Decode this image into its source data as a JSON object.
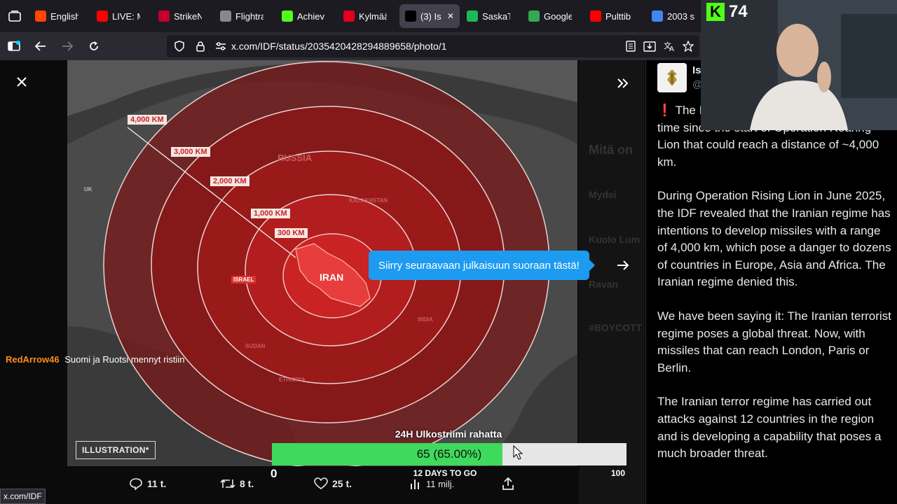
{
  "browser": {
    "tabs": [
      {
        "title": "English",
        "icon": "reddit-icon",
        "color": "#ff4500"
      },
      {
        "title": "LIVE: M",
        "icon": "youtube-icon",
        "color": "#ff0000"
      },
      {
        "title": "StrikeN",
        "icon": "mute-icon",
        "color": "#c4002b"
      },
      {
        "title": "Flightra",
        "icon": "radar-icon",
        "color": "#888888"
      },
      {
        "title": "Achiev",
        "icon": "kick-icon",
        "color": "#53fc18"
      },
      {
        "title": "Kylmää",
        "icon": "news-icon",
        "color": "#e3001b"
      },
      {
        "title": "(3) Is",
        "icon": "x-icon",
        "color": "#000000"
      },
      {
        "title": "SaskaT",
        "icon": "spotify-icon",
        "color": "#1db954"
      },
      {
        "title": "Google",
        "icon": "maps-icon",
        "color": "#34a853"
      },
      {
        "title": "Pulttib",
        "icon": "youtube-icon",
        "color": "#ff0000"
      },
      {
        "title": "2003 s",
        "icon": "google-icon",
        "color": "#4285f4"
      }
    ],
    "active_tab_index": 6,
    "url": "x.com/IDF/status/2035420428294889658/photo/1",
    "status_url": "x.com/IDF"
  },
  "map": {
    "country_labels": [
      "RUSSIA",
      "KAZAKHSTAN",
      "UK",
      "SUDAN",
      "ETHIOPIA",
      "INDIA"
    ],
    "iran_label": "IRAN",
    "israel_label": "ISRAEL",
    "range_labels": [
      "4,000 KM",
      "3,000 KM",
      "2,000 KM",
      "1,000 KM",
      "300 KM"
    ],
    "illustration_tag": "ILLUSTRATION*"
  },
  "tooltip": {
    "text": "Siirry seuraavaan julkaisuun suoraan tästä!"
  },
  "chat": {
    "user": "RedArrow46",
    "message": "Suomi ja Ruotsi mennyt ristiin"
  },
  "goal": {
    "title": "24H Ulkostriimi rahatta",
    "value_text": "65 (65.00%)",
    "progress": 0.65,
    "min": "0",
    "max": "100",
    "days_text": "12 DAYS TO GO"
  },
  "actions": {
    "replies": "11 t.",
    "reposts": "8 t.",
    "likes": "25 t.",
    "views": "11 milj."
  },
  "background_timeline": [
    "Mitä on",
    "Mydei",
    "Kuolo Lum",
    "Ravan",
    "#BOYCOTT"
  ],
  "tweet": {
    "author_name": "Is",
    "author_handle": "@",
    "paragraphs": [
      "The I... a long-range missile for the first time since the start of Operation Roaring Lion that could reach a distance of ~4,000 km.",
      "During Operation Rising Lion in June 2025, the IDF revealed that the Iranian regime has intentions to develop missiles with a range of 4,000 km, which pose a danger to dozens of countries in Europe, Asia and Africa. The Iranian regime denied this.",
      "We have been saying it: The Iranian terrorist regime poses a global threat. Now, with missiles that can reach London, Paris or Berlin.",
      "The Iranian terror regime has carried out attacks against 12 countries in the region and is developing a capability that poses a much broader threat."
    ]
  },
  "stream": {
    "viewer_count": "74",
    "platform_icon": "kick-logo"
  }
}
